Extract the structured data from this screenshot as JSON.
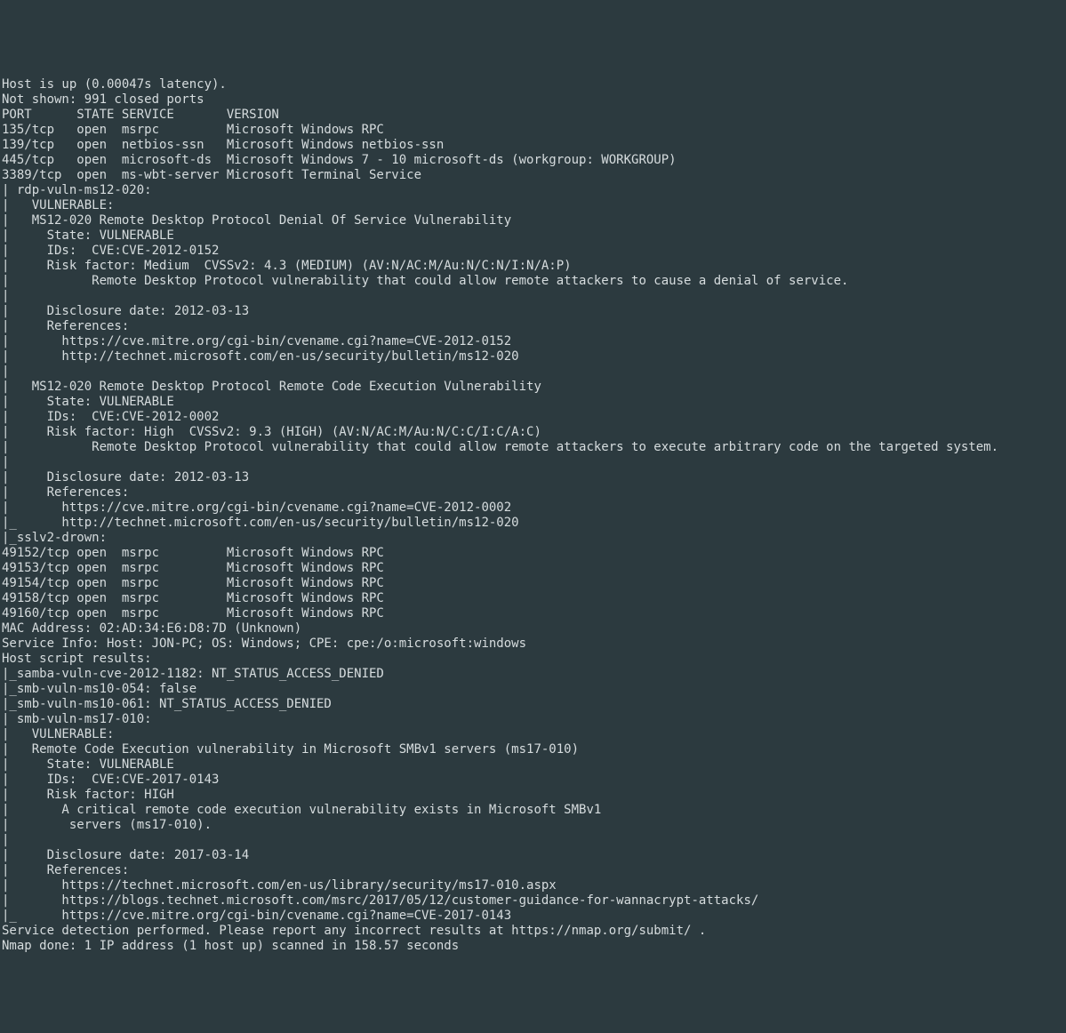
{
  "lines": [
    "Host is up (0.00047s latency).",
    "Not shown: 991 closed ports",
    "PORT      STATE SERVICE       VERSION",
    "135/tcp   open  msrpc         Microsoft Windows RPC",
    "139/tcp   open  netbios-ssn   Microsoft Windows netbios-ssn",
    "445/tcp   open  microsoft-ds  Microsoft Windows 7 - 10 microsoft-ds (workgroup: WORKGROUP)",
    "3389/tcp  open  ms-wbt-server Microsoft Terminal Service",
    "| rdp-vuln-ms12-020: ",
    "|   VULNERABLE:",
    "|   MS12-020 Remote Desktop Protocol Denial Of Service Vulnerability",
    "|     State: VULNERABLE",
    "|     IDs:  CVE:CVE-2012-0152",
    "|     Risk factor: Medium  CVSSv2: 4.3 (MEDIUM) (AV:N/AC:M/Au:N/C:N/I:N/A:P)",
    "|           Remote Desktop Protocol vulnerability that could allow remote attackers to cause a denial of service.",
    "|           ",
    "|     Disclosure date: 2012-03-13",
    "|     References:",
    "|       https://cve.mitre.org/cgi-bin/cvename.cgi?name=CVE-2012-0152",
    "|       http://technet.microsoft.com/en-us/security/bulletin/ms12-020",
    "|   ",
    "|   MS12-020 Remote Desktop Protocol Remote Code Execution Vulnerability",
    "|     State: VULNERABLE",
    "|     IDs:  CVE:CVE-2012-0002",
    "|     Risk factor: High  CVSSv2: 9.3 (HIGH) (AV:N/AC:M/Au:N/C:C/I:C/A:C)",
    "|           Remote Desktop Protocol vulnerability that could allow remote attackers to execute arbitrary code on the targeted system.",
    "|           ",
    "|     Disclosure date: 2012-03-13",
    "|     References:",
    "|       https://cve.mitre.org/cgi-bin/cvename.cgi?name=CVE-2012-0002",
    "|_      http://technet.microsoft.com/en-us/security/bulletin/ms12-020",
    "|_sslv2-drown: ",
    "49152/tcp open  msrpc         Microsoft Windows RPC",
    "49153/tcp open  msrpc         Microsoft Windows RPC",
    "49154/tcp open  msrpc         Microsoft Windows RPC",
    "49158/tcp open  msrpc         Microsoft Windows RPC",
    "49160/tcp open  msrpc         Microsoft Windows RPC",
    "MAC Address: 02:AD:34:E6:D8:7D (Unknown)",
    "Service Info: Host: JON-PC; OS: Windows; CPE: cpe:/o:microsoft:windows",
    "",
    "Host script results:",
    "|_samba-vuln-cve-2012-1182: NT_STATUS_ACCESS_DENIED",
    "|_smb-vuln-ms10-054: false",
    "|_smb-vuln-ms10-061: NT_STATUS_ACCESS_DENIED",
    "| smb-vuln-ms17-010: ",
    "|   VULNERABLE:",
    "|   Remote Code Execution vulnerability in Microsoft SMBv1 servers (ms17-010)",
    "|     State: VULNERABLE",
    "|     IDs:  CVE:CVE-2017-0143",
    "|     Risk factor: HIGH",
    "|       A critical remote code execution vulnerability exists in Microsoft SMBv1",
    "|        servers (ms17-010).",
    "|           ",
    "|     Disclosure date: 2017-03-14",
    "|     References:",
    "|       https://technet.microsoft.com/en-us/library/security/ms17-010.aspx",
    "|       https://blogs.technet.microsoft.com/msrc/2017/05/12/customer-guidance-for-wannacrypt-attacks/",
    "|_      https://cve.mitre.org/cgi-bin/cvename.cgi?name=CVE-2017-0143",
    "",
    "Service detection performed. Please report any incorrect results at https://nmap.org/submit/ .",
    "Nmap done: 1 IP address (1 host up) scanned in 158.57 seconds"
  ]
}
